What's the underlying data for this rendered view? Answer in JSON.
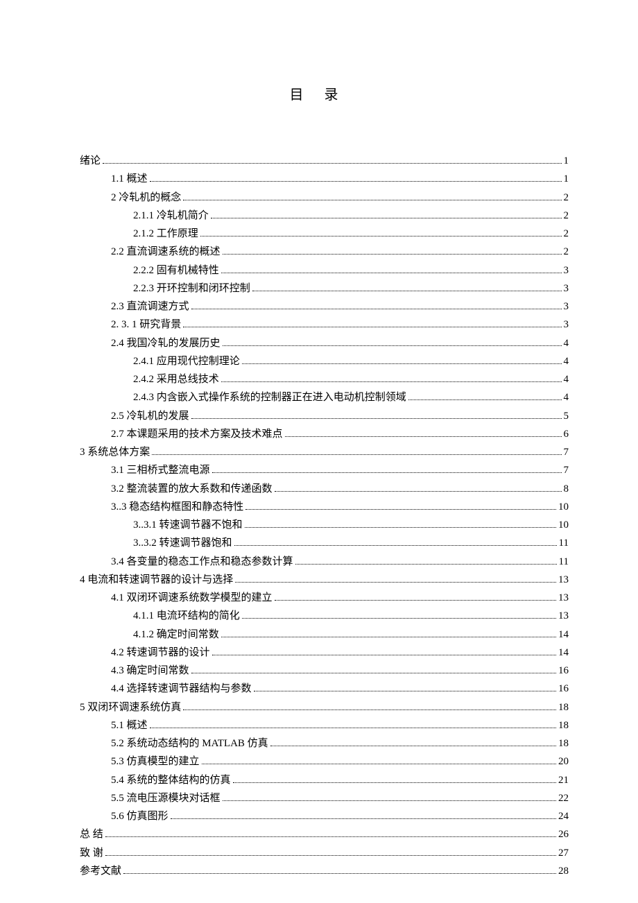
{
  "title": "目录",
  "entries": [
    {
      "level": 0,
      "label": "绪论",
      "page": "1"
    },
    {
      "level": 1,
      "label": "1.1  概述",
      "page": "1"
    },
    {
      "level": 1,
      "label": "2 冷轧机的概念",
      "page": "2"
    },
    {
      "level": 2,
      "label": "2.1.1 冷轧机简介",
      "page": "2"
    },
    {
      "level": 2,
      "label": "2.1.2 工作原理",
      "page": "2"
    },
    {
      "level": 1,
      "label": "2.2 直流调速系统的概述",
      "page": "2"
    },
    {
      "level": 2,
      "label": "2.2.2 固有机械特性",
      "page": "3"
    },
    {
      "level": 2,
      "label": "2.2.3 开环控制和闭环控制",
      "page": "3"
    },
    {
      "level": 1,
      "label": "2.3 直流调速方式",
      "page": "3"
    },
    {
      "level": 1,
      "label": "2. 3. 1 研究背景",
      "page": "3"
    },
    {
      "level": 1,
      "label": "2.4 我国冷轧的发展历史",
      "page": "4"
    },
    {
      "level": 2,
      "label": "2.4.1 应用现代控制理论",
      "page": "4"
    },
    {
      "level": 2,
      "label": "2.4.2 采用总线技术",
      "page": "4"
    },
    {
      "level": 2,
      "label": "2.4.3 内含嵌入式操作系统的控制器正在进入电动机控制领域",
      "page": "4"
    },
    {
      "level": 1,
      "label": "2.5 冷轧机的发展",
      "page": "5"
    },
    {
      "level": 1,
      "label": "2.7  本课题采用的技术方案及技术难点",
      "page": "6"
    },
    {
      "level": 0,
      "label": "3  系统总体方案",
      "page": "7"
    },
    {
      "level": 1,
      "label": "3.1  三相桥式整流电源",
      "page": "7"
    },
    {
      "level": 1,
      "label": "3.2  整流装置的放大系数和传递函数",
      "page": "8"
    },
    {
      "level": 1,
      "label": "3..3  稳态结构框图和静态特性",
      "page": "10"
    },
    {
      "level": 2,
      "label": "3..3.1  转速调节器不饱和",
      "page": "10"
    },
    {
      "level": 2,
      "label": "3..3.2  转速调节器饱和",
      "page": "11"
    },
    {
      "level": 1,
      "label": "3.4  各变量的稳态工作点和稳态参数计算",
      "page": "11"
    },
    {
      "level": 0,
      "label": "4  电流和转速调节器的设计与选择",
      "page": "13"
    },
    {
      "level": 1,
      "label": "4.1    双闭环调速系统数学模型的建立",
      "page": "13"
    },
    {
      "level": 2,
      "label": "4.1.1  电流环结构的简化",
      "page": "13"
    },
    {
      "level": 2,
      "label": "4.1.2    确定时间常数",
      "page": "14"
    },
    {
      "level": 1,
      "label": "4.2    转速调节器的设计",
      "page": "14"
    },
    {
      "level": 1,
      "label": "4.3  确定时间常数",
      "page": "16"
    },
    {
      "level": 1,
      "label": "4.4    选择转速调节器结构与参数",
      "page": "16"
    },
    {
      "level": 0,
      "label": "5  双闭环调速系统仿真",
      "page": "18"
    },
    {
      "level": 1,
      "label": "5.1 概述",
      "page": "18"
    },
    {
      "level": 1,
      "label": "5.2  系统动态结构的 MATLAB 仿真",
      "page": "18"
    },
    {
      "level": 1,
      "label": "5.3  仿真模型的建立",
      "page": "20"
    },
    {
      "level": 1,
      "label": "5.4  系统的整体结构的仿真",
      "page": "21"
    },
    {
      "level": 1,
      "label": "5.5 流电压源模块对话框",
      "page": "22"
    },
    {
      "level": 1,
      "label": "5.6 仿真图形",
      "page": "24"
    },
    {
      "level": 0,
      "label": "总    结",
      "page": "26"
    },
    {
      "level": 0,
      "label": "致    谢",
      "page": "27"
    },
    {
      "level": 0,
      "label": "参考文献",
      "page": "28"
    }
  ]
}
